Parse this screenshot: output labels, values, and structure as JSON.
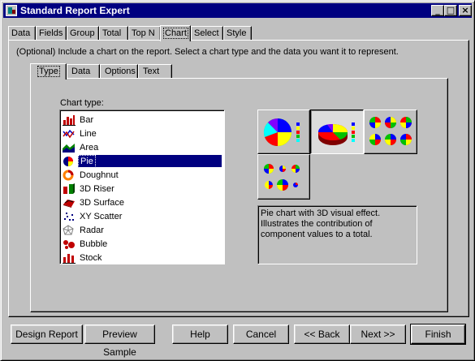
{
  "window": {
    "title": "Standard Report Expert",
    "controls": {
      "minimize": "_",
      "maximize": "□",
      "close": "×"
    }
  },
  "outer_tabs": [
    "Data",
    "Fields",
    "Group",
    "Total",
    "Top N",
    "Chart",
    "Select",
    "Style"
  ],
  "outer_active_tab": "Chart",
  "description": "(Optional) Include a chart on the report. Select a chart type and the data you want it to represent.",
  "inner_tabs": [
    "Type",
    "Data",
    "Options",
    "Text"
  ],
  "inner_active_tab": "Type",
  "chart_type_label": "Chart type:",
  "chart_types": [
    {
      "label": "Bar",
      "icon": "bar-chart-icon"
    },
    {
      "label": "Line",
      "icon": "line-chart-icon"
    },
    {
      "label": "Area",
      "icon": "area-chart-icon"
    },
    {
      "label": "Pie",
      "icon": "pie-chart-icon"
    },
    {
      "label": "Doughnut",
      "icon": "doughnut-chart-icon"
    },
    {
      "label": "3D Riser",
      "icon": "3d-riser-icon"
    },
    {
      "label": "3D Surface",
      "icon": "3d-surface-icon"
    },
    {
      "label": "XY Scatter",
      "icon": "xy-scatter-icon"
    },
    {
      "label": "Radar",
      "icon": "radar-chart-icon"
    },
    {
      "label": "Bubble",
      "icon": "bubble-chart-icon"
    },
    {
      "label": "Stock",
      "icon": "stock-chart-icon"
    }
  ],
  "selected_chart_type": "Pie",
  "chart_variant_description": "Pie chart with 3D visual effect. Illustrates the contribution of component values to a total.",
  "buttons": {
    "design_report": "Design Report",
    "preview_sample": "Preview Sample",
    "help": "Help",
    "cancel": "Cancel",
    "back": "<< Back",
    "next": "Next >>",
    "finish": "Finish"
  },
  "colors": {
    "title_bar": "#000080",
    "face": "#c0c0c0",
    "selection": "#000080"
  }
}
